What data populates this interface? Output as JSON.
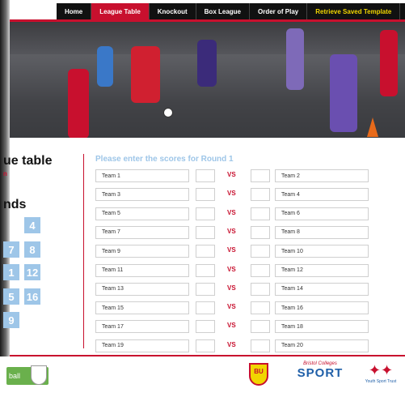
{
  "nav": {
    "items": [
      {
        "label": "Home",
        "state": "normal"
      },
      {
        "label": "League Table",
        "state": "active"
      },
      {
        "label": "Knockout",
        "state": "normal"
      },
      {
        "label": "Box League",
        "state": "normal"
      },
      {
        "label": "Order of Play",
        "state": "normal"
      },
      {
        "label": "Retrieve Saved Template",
        "state": "highlight"
      }
    ]
  },
  "side": {
    "title": "ue table",
    "subtitle": "n",
    "rounds_heading": "nds",
    "rounds": [
      "4",
      "7",
      "8",
      "1",
      "12",
      "5",
      "16",
      "9"
    ]
  },
  "form": {
    "title": "Please enter the scores for Round 1",
    "vs_label": "VS",
    "matches": [
      {
        "home": "Team 1",
        "away": "Team 2"
      },
      {
        "home": "Team 3",
        "away": "Team 4"
      },
      {
        "home": "Team 5",
        "away": "Team 6"
      },
      {
        "home": "Team 7",
        "away": "Team 8"
      },
      {
        "home": "Team 9",
        "away": "Team 10"
      },
      {
        "home": "Team 11",
        "away": "Team 12"
      },
      {
        "home": "Team 13",
        "away": "Team 14"
      },
      {
        "home": "Team 15",
        "away": "Team 16"
      },
      {
        "home": "Team 17",
        "away": "Team 18"
      },
      {
        "home": "Team 19",
        "away": "Team 20"
      }
    ]
  },
  "footer": {
    "left_text": "ball",
    "bu_logo": "BU",
    "bc_top": "Bristol Colleges",
    "bc_main": "SPORT",
    "yst_text": "Youth Sport Trust"
  },
  "colors": {
    "accent": "#c8102e",
    "blue": "#9ec6e8",
    "highlight": "#f1d600"
  }
}
